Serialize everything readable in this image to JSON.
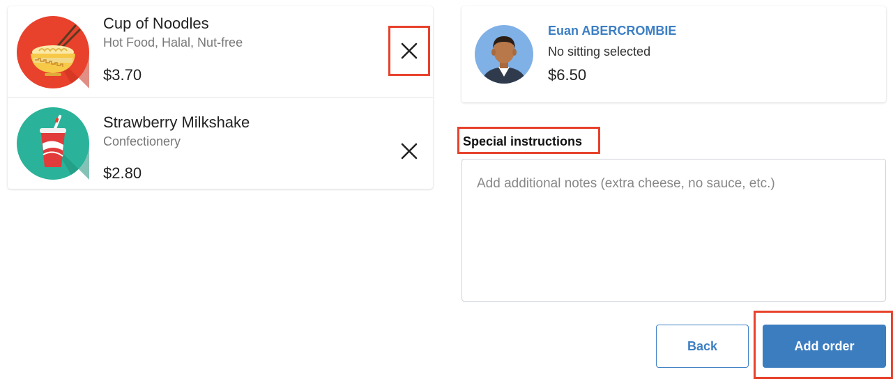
{
  "cart": {
    "items": [
      {
        "name": "Cup of Noodles",
        "tags": "Hot Food, Halal, Nut-free",
        "price": "$3.70",
        "icon": "noodles-icon",
        "icon_bg": "#e8412c",
        "remove_icon": "close-icon"
      },
      {
        "name": "Strawberry Milkshake",
        "tags": "Confectionery",
        "price": "$2.80",
        "icon": "milkshake-icon",
        "icon_bg": "#2ab39a",
        "remove_icon": "close-icon"
      }
    ]
  },
  "student": {
    "name": "Euan ABERCROMBIE",
    "sitting": "No sitting selected",
    "balance": "$6.50",
    "avatar": "avatar-icon"
  },
  "instructions": {
    "label": "Special instructions",
    "placeholder": "Add additional notes (extra cheese, no sauce, etc.)",
    "value": ""
  },
  "actions": {
    "back_label": "Back",
    "add_label": "Add order"
  },
  "colors": {
    "accent": "#3c7dc0",
    "highlight": "#e8412c",
    "text_muted": "#777777"
  }
}
